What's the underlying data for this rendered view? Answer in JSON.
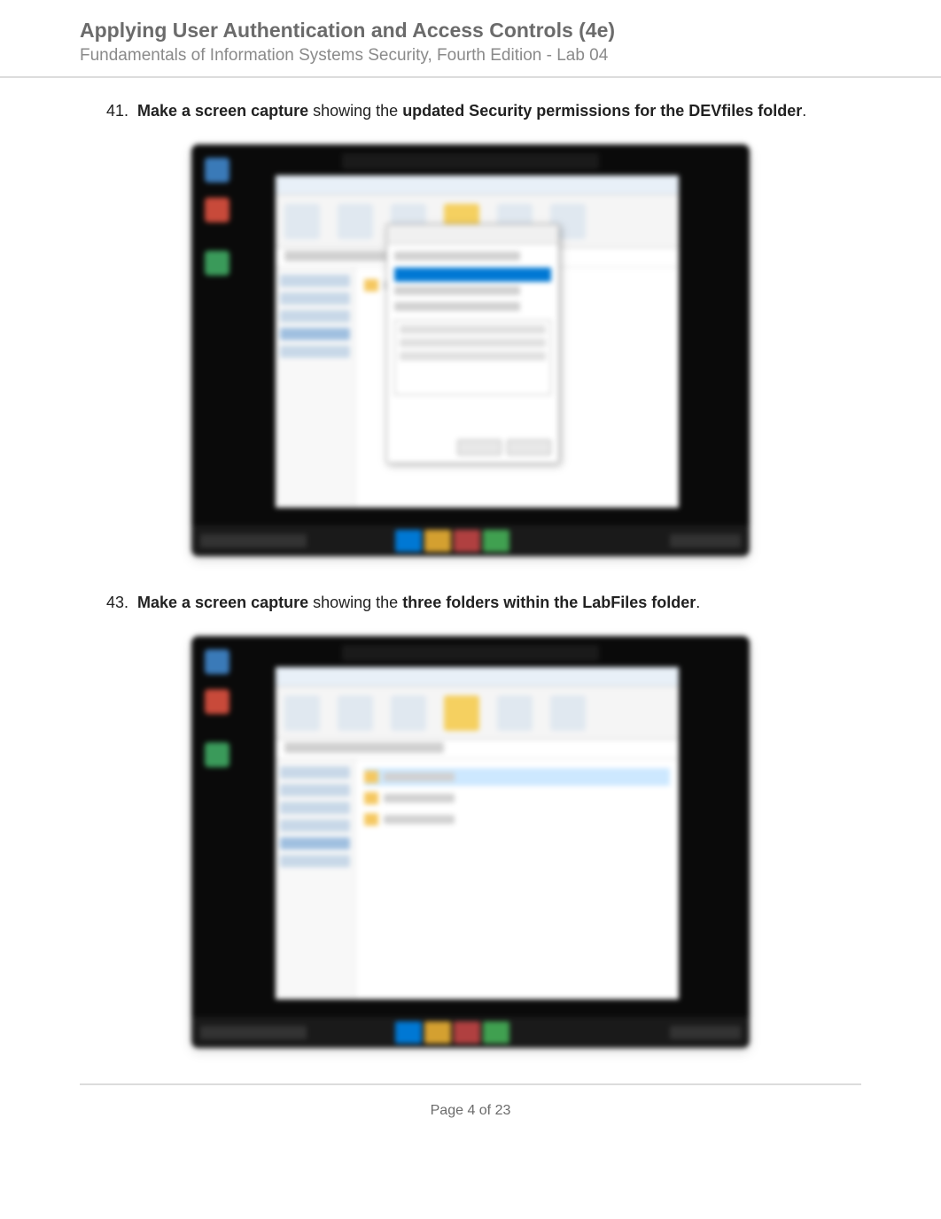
{
  "header": {
    "title": "Applying User Authentication and Access Controls (4e)",
    "subtitle": "Fundamentals of Information Systems Security, Fourth Edition - Lab 04"
  },
  "instructions": [
    {
      "number": "41.",
      "bold_intro": "Make a screen capture",
      "middle": " showing the ",
      "bold_subject": "updated Security permissions for the DEVfiles folder",
      "period": "."
    },
    {
      "number": "43.",
      "bold_intro": "Make a screen capture",
      "middle": " showing the ",
      "bold_subject": "three folders within the LabFiles folder",
      "period": "."
    }
  ],
  "footer": {
    "page_text": "Page 4 of 23"
  }
}
